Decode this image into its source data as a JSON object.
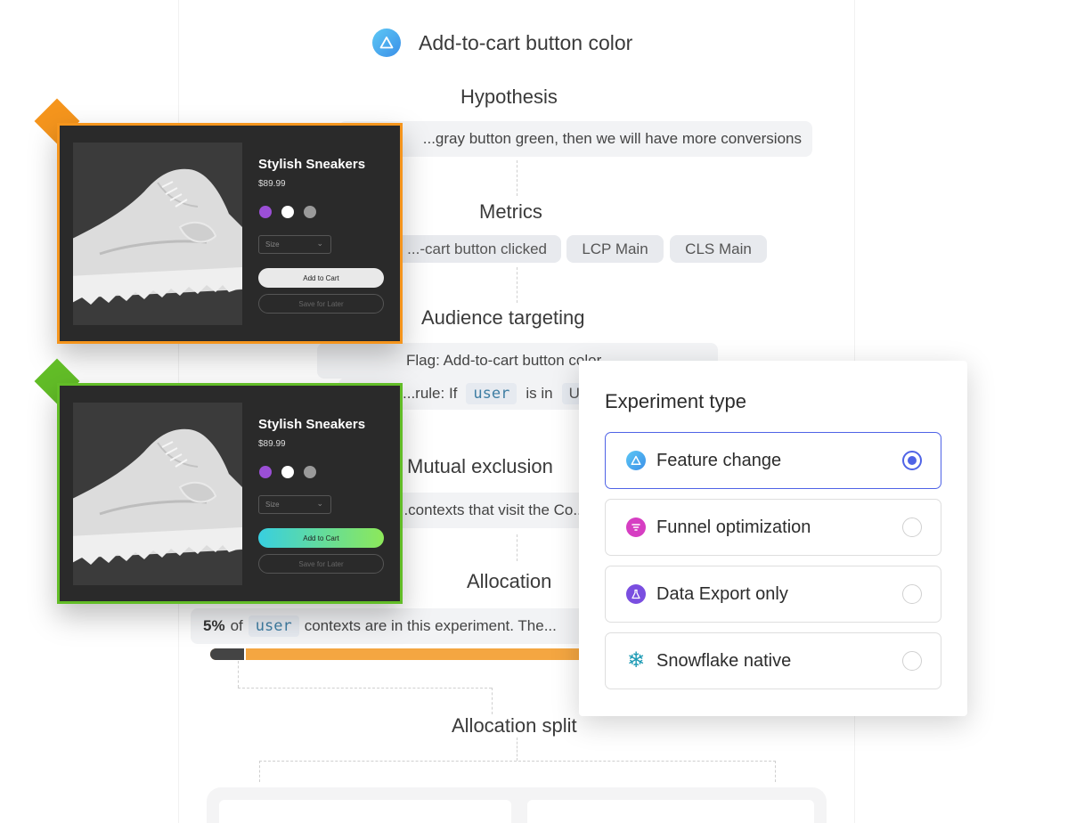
{
  "experiment": {
    "title": "Add-to-cart button color"
  },
  "hypothesis": {
    "heading": "Hypothesis",
    "text": "...gray button green, then we will have more conversions"
  },
  "metrics": {
    "heading": "Metrics",
    "chips": [
      "...-cart button clicked",
      "LCP Main",
      "CLS Main"
    ]
  },
  "audience": {
    "heading": "Audience targeting",
    "flag_text": "Flag: Add-to-cart button color",
    "rule_prefix": "...rule:  If",
    "rule_context": "user",
    "rule_op": "is in",
    "rule_value": "U..."
  },
  "mutual_exclusion": {
    "heading": "Mutual exclusion",
    "text": "...contexts that visit the Co..."
  },
  "allocation": {
    "heading": "Allocation",
    "percent_label": "5%",
    "of_text": "of",
    "context": "user",
    "text": "contexts are in this experiment.  The...",
    "progress_fraction": 0.05
  },
  "allocation_split": {
    "heading": "Allocation split"
  },
  "variants": [
    {
      "id": "control",
      "border_color": "#f5951d",
      "product_name": "Stylish Sneakers",
      "price": "$89.99",
      "size_placeholder": "Size",
      "cart_label": "Add to Cart",
      "save_label": "Save for Later",
      "swatches": [
        "#9b4fd6",
        "#ffffff",
        "#9a9a9a"
      ]
    },
    {
      "id": "treatment",
      "border_color": "#62bd27",
      "product_name": "Stylish Sneakers",
      "price": "$89.99",
      "size_placeholder": "Size",
      "cart_label": "Add to Cart",
      "save_label": "Save for Later",
      "swatches": [
        "#9b4fd6",
        "#ffffff",
        "#9a9a9a"
      ]
    }
  ],
  "experiment_type": {
    "title": "Experiment type",
    "options": [
      {
        "label": "Feature change",
        "icon": "triangle-icon",
        "color": "#3ba7ec",
        "selected": true
      },
      {
        "label": "Funnel optimization",
        "icon": "funnel-icon",
        "color": "#d63ec2",
        "selected": false
      },
      {
        "label": "Data Export only",
        "icon": "flask-icon",
        "color": "#7a4ee0",
        "selected": false
      },
      {
        "label": "Snowflake native",
        "icon": "snowflake-icon",
        "color": "#1f9bb5",
        "selected": false
      }
    ]
  }
}
